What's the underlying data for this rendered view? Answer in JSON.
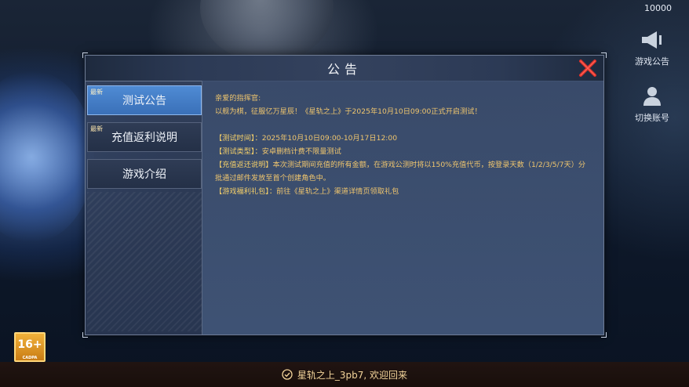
{
  "status": {
    "score": "10000"
  },
  "side_buttons": {
    "notice_label": "游戏公告",
    "switch_label": "切换账号"
  },
  "rating": {
    "age": "16+",
    "org": "CADPA"
  },
  "dialog": {
    "title": "公告",
    "tabs": [
      {
        "label": "测试公告",
        "flag": "最新",
        "active": true
      },
      {
        "label": "充值返利说明",
        "flag": "最新",
        "active": false
      },
      {
        "label": "游戏介绍",
        "flag": "",
        "active": false
      }
    ],
    "content": {
      "greeting": "亲爱的指挥官:",
      "intro": "以舰为棋，征服亿万星辰！《星轨之上》于2025年10月10日09:00正式开启测试！",
      "items": [
        {
          "key": "【测试时间】：",
          "value": "2025年10月10日09:00-10月17日12:00"
        },
        {
          "key": "【测试类型】：",
          "value": "安卓删档计费不限量测试"
        },
        {
          "key": "【充值返还说明】",
          "value": "本次测试期间充值的所有金额，在游戏公测时将以150%充值代币，按登录天数（1/2/3/5/7天）分批通过邮件发放至首个创建角色中。"
        },
        {
          "key": "【游戏福利礼包】：",
          "value": "前往《星轨之上》渠道详情页领取礼包"
        }
      ]
    }
  },
  "welcome": {
    "text": "星轨之上_3pb7, 欢迎回来"
  },
  "colors": {
    "accent_tab": "#4a86d0",
    "content_text": "#f0c66e",
    "close_red": "#e0312b"
  }
}
